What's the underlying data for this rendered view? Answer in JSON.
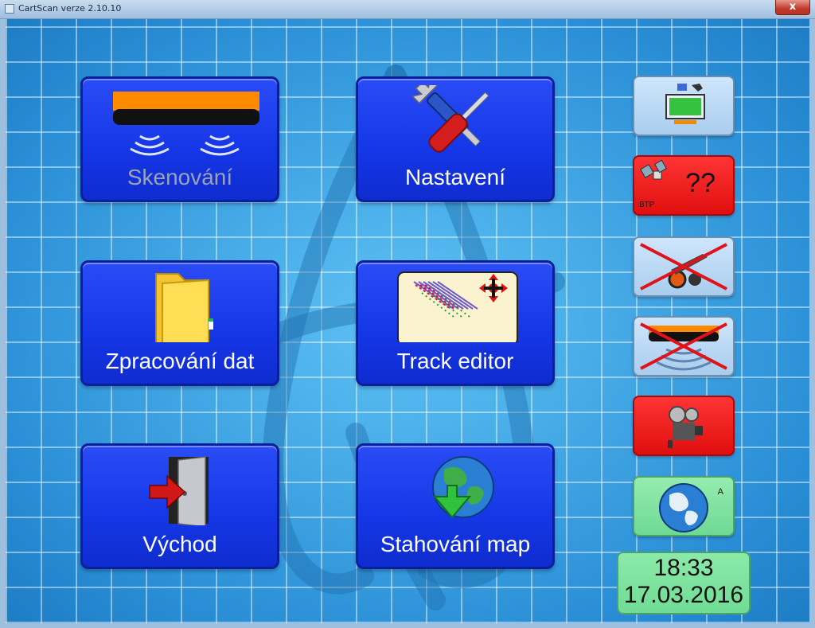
{
  "window": {
    "title": "CartScan verze 2.10.10",
    "close_label": "x"
  },
  "tiles": [
    {
      "label": "Skenování",
      "icon": "scanner-icon",
      "enabled": false
    },
    {
      "label": "Nastavení",
      "icon": "tools-icon",
      "enabled": true
    },
    {
      "label": "Zpracování dat",
      "icon": "folder-icon",
      "enabled": true
    },
    {
      "label": "Track editor",
      "icon": "track-editor-icon",
      "enabled": true
    },
    {
      "label": "Východ",
      "icon": "exit-door-icon",
      "enabled": true
    },
    {
      "label": "Stahování map",
      "icon": "globe-download-icon",
      "enabled": true
    }
  ],
  "side_buttons": [
    {
      "name": "battery-status",
      "icon": "battery-monitor-icon",
      "color": "#bfdcf7"
    },
    {
      "name": "gps-status",
      "text": "??",
      "subtext": "BTP",
      "icon": "satellite-icon",
      "color": "#f01c1c"
    },
    {
      "name": "cart-status",
      "icon": "cart-crossed-icon",
      "color": "#bfdcf7"
    },
    {
      "name": "scanner-status",
      "icon": "scanner-crossed-icon",
      "color": "#bfdcf7"
    },
    {
      "name": "camera-status",
      "icon": "camera-icon",
      "color": "#f01c1c"
    },
    {
      "name": "map-status",
      "text": "A",
      "icon": "globe-icon",
      "color": "#7fe3a0"
    }
  ],
  "clock": {
    "time": "18:33",
    "date": "17.03.2016"
  }
}
